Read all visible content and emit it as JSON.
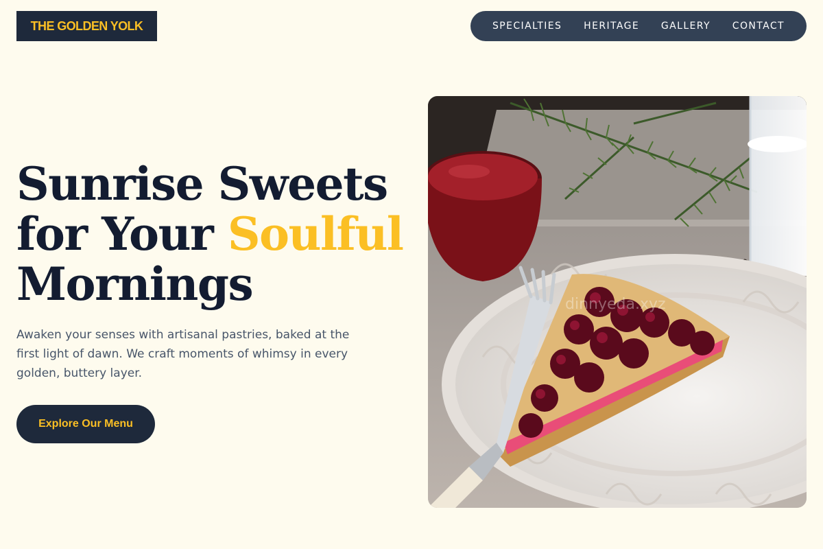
{
  "brand": {
    "name": "THE GOLDEN YOLK"
  },
  "nav": {
    "items": [
      "SPECIALTIES",
      "HERITAGE",
      "GALLERY",
      "CONTACT"
    ]
  },
  "hero": {
    "title_line1": "Sunrise Sweets",
    "title_line2_prefix": "for Your ",
    "title_line2_accent": "Soulful",
    "title_line3": "Mornings",
    "subtitle": "Awaken your senses with artisanal pastries, baked at the first light of dawn. We craft moments of whimsy in every golden, buttery layer.",
    "cta_label": "Explore Our Menu"
  },
  "image": {
    "subject": "cherry tart slice on white plate with fork, cherry jam bowl, glass of milk, pine branches",
    "watermark": "dinnyeda.xyz"
  },
  "colors": {
    "background": "#fefbee",
    "navy": "#1e293b",
    "nav_bg": "#334155",
    "accent_gold": "#fbbf24",
    "body_text": "#475569"
  }
}
